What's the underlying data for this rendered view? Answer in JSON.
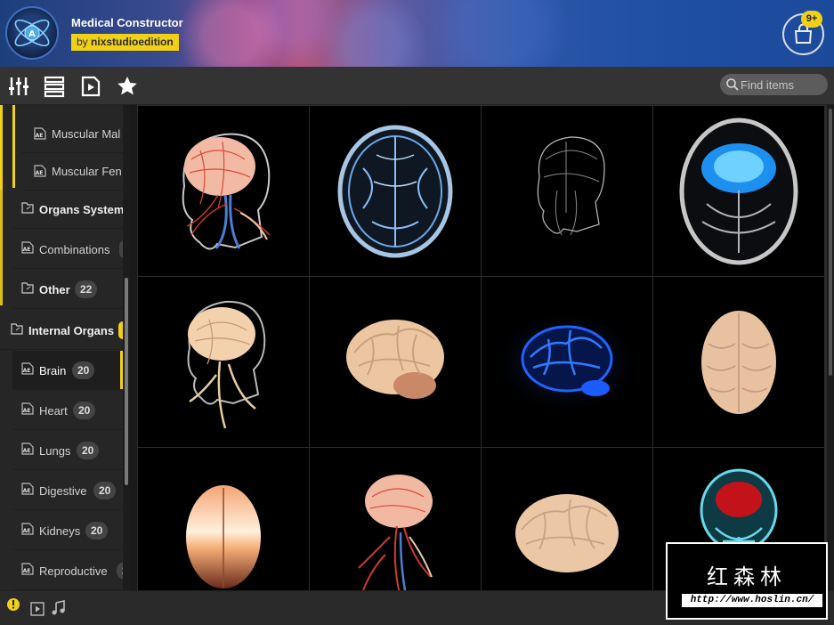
{
  "header": {
    "app_title": "Medical Constructor",
    "author_prefix": "by",
    "author_name": "nixstudioedition",
    "cart_badge": "9+"
  },
  "toolbar": {
    "tools": [
      "sliders-icon",
      "list-view-icon",
      "play-file-icon",
      "star-icon"
    ],
    "search_placeholder": "Find items"
  },
  "sidebar": {
    "items": [
      {
        "label": "Muscular Mal",
        "kind": "file",
        "level": 2
      },
      {
        "label": "Muscular Fen",
        "kind": "file",
        "level": 2
      },
      {
        "label": "Organs System",
        "kind": "folder",
        "level": 1
      },
      {
        "label": "Combinations",
        "kind": "file",
        "level": 1
      },
      {
        "label": "Other",
        "kind": "folder",
        "level": 1,
        "count": "22"
      },
      {
        "label": "Internal Organs",
        "kind": "folder",
        "level": 0
      },
      {
        "label": "Brain",
        "kind": "file",
        "level": 1,
        "count": "20",
        "active": true
      },
      {
        "label": "Heart",
        "kind": "file",
        "level": 1,
        "count": "20"
      },
      {
        "label": "Lungs",
        "kind": "file",
        "level": 1,
        "count": "20"
      },
      {
        "label": "Digestive",
        "kind": "file",
        "level": 1,
        "count": "20"
      },
      {
        "label": "Kidneys",
        "kind": "file",
        "level": 1,
        "count": "20"
      },
      {
        "label": "Reproductive",
        "kind": "file",
        "level": 1,
        "count": "2"
      }
    ]
  },
  "grid": {
    "items": [
      {
        "name": "head-nerves-vessels-side"
      },
      {
        "name": "brain-xray-top-blue"
      },
      {
        "name": "head-wireframe-side"
      },
      {
        "name": "brain-glow-top-cyan"
      },
      {
        "name": "skull-brain-side"
      },
      {
        "name": "brain-side-pink"
      },
      {
        "name": "brain-glow-blue-side"
      },
      {
        "name": "brain-top-pink"
      },
      {
        "name": "brain-front-glow-orange"
      },
      {
        "name": "head-vessels-brain"
      },
      {
        "name": "brain-side-lit"
      },
      {
        "name": "skull-xray-red-brain"
      }
    ]
  },
  "footer": {
    "icons": [
      "warning-icon",
      "video-icon",
      "music-icon",
      "compare-icon",
      "fullscreen-icon"
    ]
  },
  "watermark": {
    "chinese_text": "红森林",
    "url": "http://www.hoslin.cn/"
  },
  "colors": {
    "accent": "#f1d117",
    "panel": "#333333",
    "sidebar": "#262626"
  }
}
